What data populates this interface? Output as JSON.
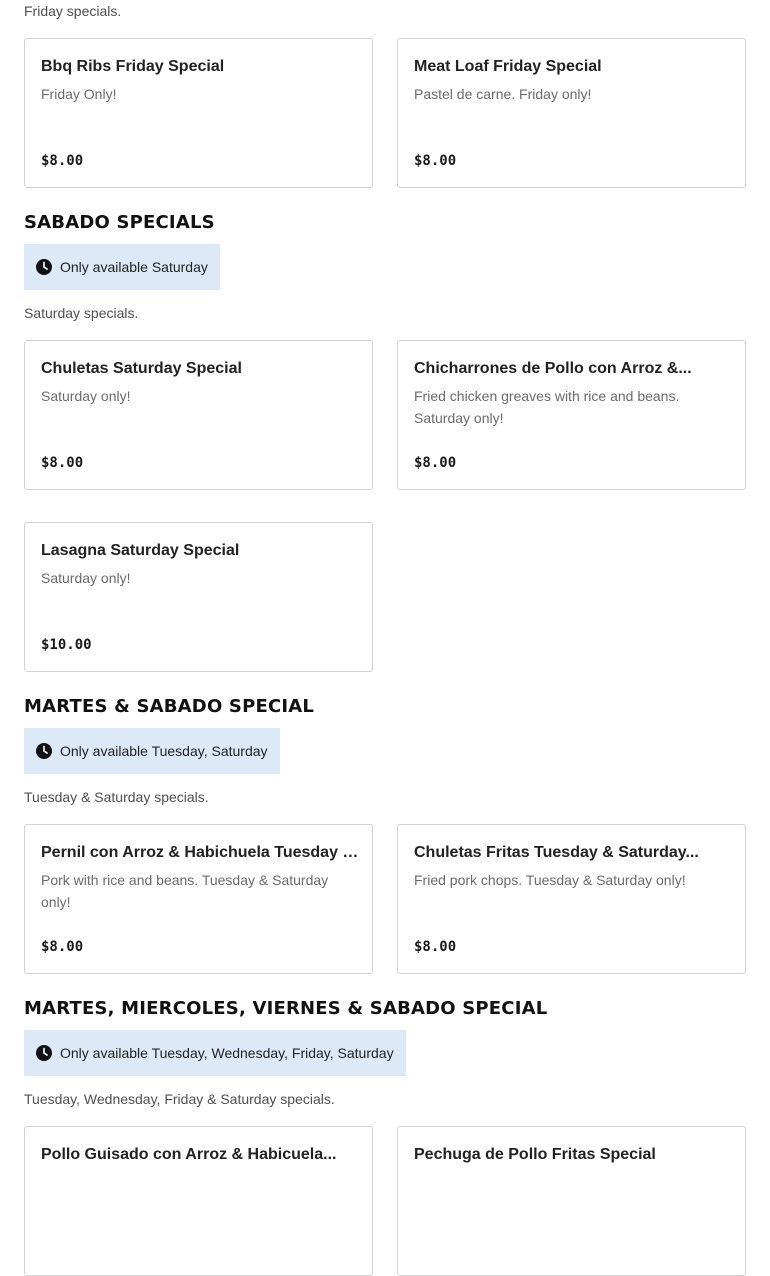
{
  "friday": {
    "description": "Friday specials.",
    "items": [
      {
        "name": "Bbq Ribs Friday Special",
        "description": "Friday Only!",
        "price": "$8.00"
      },
      {
        "name": "Meat Loaf Friday Special",
        "description": "Pastel de carne. Friday only!",
        "price": "$8.00"
      }
    ]
  },
  "sabado": {
    "heading": "SABADO SPECIALS",
    "availability": "Only available Saturday",
    "description": "Saturday specials.",
    "items": [
      {
        "name": "Chuletas Saturday Special",
        "description": "Saturday only!",
        "price": "$8.00"
      },
      {
        "name": "Chicharrones de Pollo con Arroz &...",
        "description": "Fried chicken greaves with rice and beans. Saturday only!",
        "price": "$8.00"
      },
      {
        "name": "Lasagna Saturday Special",
        "description": "Saturday only!",
        "price": "$10.00"
      }
    ]
  },
  "martes_sabado": {
    "heading": "MARTES & SABADO SPECIAL",
    "availability": "Only available Tuesday, Saturday",
    "description": "Tuesday & Saturday specials.",
    "items": [
      {
        "name": "Pernil con Arroz & Habichuela Tuesday &...",
        "description": "Pork with rice and beans. Tuesday & Saturday only!",
        "price": "$8.00"
      },
      {
        "name": "Chuletas Fritas Tuesday & Saturday...",
        "description": "Fried pork chops. Tuesday & Saturday only!",
        "price": "$8.00"
      }
    ]
  },
  "mmvs": {
    "heading": "MARTES, MIERCOLES, VIERNES & SABADO SPECIAL",
    "availability": "Only available Tuesday, Wednesday, Friday, Saturday",
    "description": "Tuesday, Wednesday, Friday & Saturday specials.",
    "items": [
      {
        "name": "Pollo Guisado con Arroz & Habicuela..."
      },
      {
        "name": "Pechuga de Pollo Fritas Special"
      }
    ]
  },
  "icons": {
    "availability": "clock-icon"
  },
  "colors": {
    "availability_bg": "#dde9f7",
    "card_border": "#d2d2d2"
  }
}
